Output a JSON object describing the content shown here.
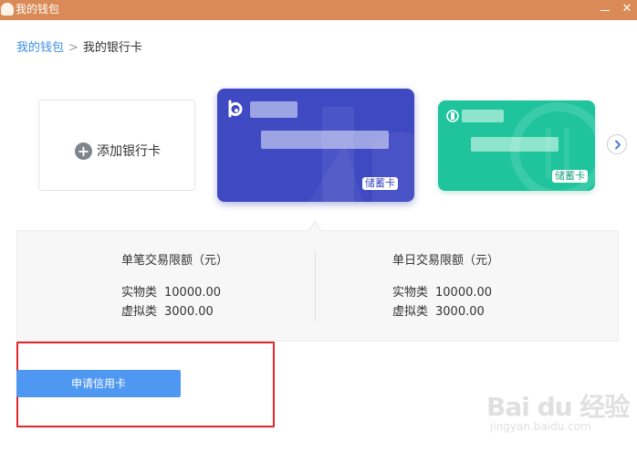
{
  "window": {
    "title": "我的钱包",
    "minimize_label": "—",
    "close_label": "✕",
    "accent_color": "#d98a56"
  },
  "breadcrumb": {
    "root": "我的钱包",
    "separator": ">",
    "current": "我的银行卡"
  },
  "add_card": {
    "plus": "+",
    "label": "添加银行卡"
  },
  "cards": [
    {
      "type_label": "储蓄卡",
      "color": "#3f49c2",
      "selected": true
    },
    {
      "type_label": "储蓄卡",
      "color": "#1fc49c",
      "selected": false
    }
  ],
  "next_arrow_icon": "chevron-right-icon",
  "limits": {
    "single": {
      "title": "单笔交易限额（元）",
      "rows": [
        {
          "label": "实物类",
          "value": "10000.00"
        },
        {
          "label": "虚拟类",
          "value": "3000.00"
        }
      ]
    },
    "daily": {
      "title": "单日交易限额（元）",
      "rows": [
        {
          "label": "实物类",
          "value": "10000.00"
        },
        {
          "label": "虚拟类",
          "value": "3000.00"
        }
      ]
    }
  },
  "apply_button_label": "申请信用卡",
  "watermark": {
    "main": "Bai du 经验",
    "sub": "jingyan.baidu.com"
  }
}
